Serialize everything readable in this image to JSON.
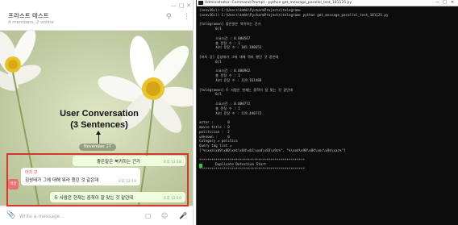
{
  "telegram": {
    "chat_title": "프라스트 테스트",
    "chat_subtitle": "4 members, 2 online",
    "annotation_line1": "User Conversation",
    "annotation_line2": "(3 Sentences)",
    "date_label": "November 27",
    "messages": [
      {
        "text": "좋은말은 북귀하는 건가",
        "time": "오후 12:18"
      },
      {
        "sender": "마지 강",
        "text": "김성태가 그에 대해 뭐라 했던 것 같은데",
        "time": "오후 12:19"
      },
      {
        "text": "두 사람은 현재는 중학이 잘 맞는 것 같던데",
        "time": "오후 12:19"
      }
    ],
    "avatar_initials": "마강",
    "input_placeholder": "Write a message...",
    "accent_color": "#d9362b"
  },
  "console": {
    "window_title": "Administrator: Command Prompt - python  get_message_parallel_test_181125.py",
    "lines": [
      "(venv36cl) C:\\Users\\kmhk\\PycharmProjects\\telegram>",
      "(venv36cl) C:\\Users\\kmhk\\PycharmProjects\\telegram> python get_message_parallel_test_181125.py",
      "",
      "[telegramvn] 좋은말은 북귀하는 건가",
      "        0/1",
      "",
      "        소요시간 : 0.000567",
      "        총 문장 수 : 1",
      "        처리 문장 수 : 105.100653",
      "",
      "[마지 강] 김성태가 그에 대해 뭐라 했던 것 같은데",
      "        0/1",
      "",
      "        소요시간 : 0.000962",
      "        총 문장 수 : 1",
      "        처리 문장 수 : 119.161488",
      "",
      "[telegramvn] 두 사람은 현재는 중학이 잘 맞는 것 같던데",
      "        0/1",
      "",
      "        소요시간 : 0.000772",
      "        총 문장 수 : 1",
      "        처리 문장 수 : 119.440772",
      "",
      "actor :       0",
      "movie title : 0",
      "politician :  2",
      "unknown :     0",
      "Category = politics",
      "Query tag list =",
      "[\"%\\xea\\xb9\\x80\\xec\\x84\\xb1\\xed\\x83\\x9c%\", \"%\\xed\\x98\\x84\\xec\\x9e\\xac%\"]",
      "",
      "****************************************************",
      "        Duplicate Detection Start",
      "****************************************************"
    ],
    "cursor_color": "#27c93f"
  }
}
